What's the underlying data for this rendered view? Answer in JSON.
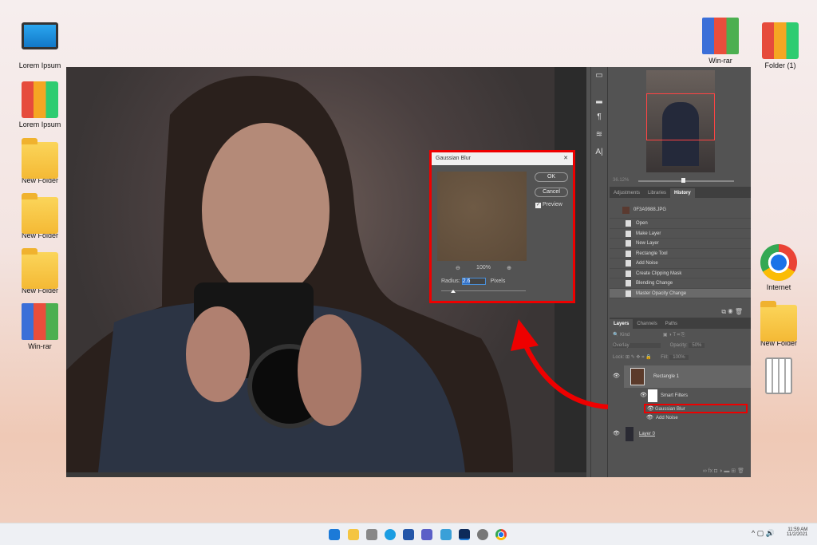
{
  "desktop": {
    "left_icons": [
      "Lorem Ipsum",
      "Lorem Ipsum",
      "New Folder",
      "New Folder",
      "New Folder",
      "Win-rar"
    ],
    "right_icons": [
      "Win-rar",
      "Folder (1)",
      "Internet",
      "New Folder",
      ""
    ]
  },
  "tools": [
    "speech-bubble",
    "ruler",
    "paragraph",
    "adjust",
    "A|"
  ],
  "navigator": {
    "zoom": "36.12%"
  },
  "history_panel": {
    "tabs": [
      "Adjustments",
      "Libraries",
      "History"
    ],
    "active_tab": "History",
    "snapshot": "0F3A9988.JPG",
    "items": [
      "Open",
      "Make Layer",
      "New Layer",
      "Rectangle Tool",
      "Add Noise",
      "Create Clipping Mask",
      "Blending Change",
      "Master Opacity Change"
    ]
  },
  "layers_panel": {
    "tabs": [
      "Layers",
      "Channels",
      "Paths"
    ],
    "filter": "Kind",
    "blend_mode": "Overlay",
    "opacity_label": "Opacity:",
    "opacity": "50%",
    "lock_label": "Lock:",
    "fill_label": "Fill:",
    "fill": "100%",
    "layers": [
      "Rectangle 1",
      "Smart Filters",
      "Gaussian Blur",
      "Add Noise",
      "Layer 0"
    ]
  },
  "dialog": {
    "title": "Gaussian Blur",
    "ok": "OK",
    "cancel": "Cancel",
    "preview": "Preview",
    "zoom": "100%",
    "radius_label": "Radius:",
    "radius": "2.6",
    "units": "Pixels",
    "close": "✕"
  },
  "taskbar": {
    "time": "11:59 AM",
    "date": "11/2/2021"
  },
  "colors": {
    "highlight": "#e00000"
  }
}
